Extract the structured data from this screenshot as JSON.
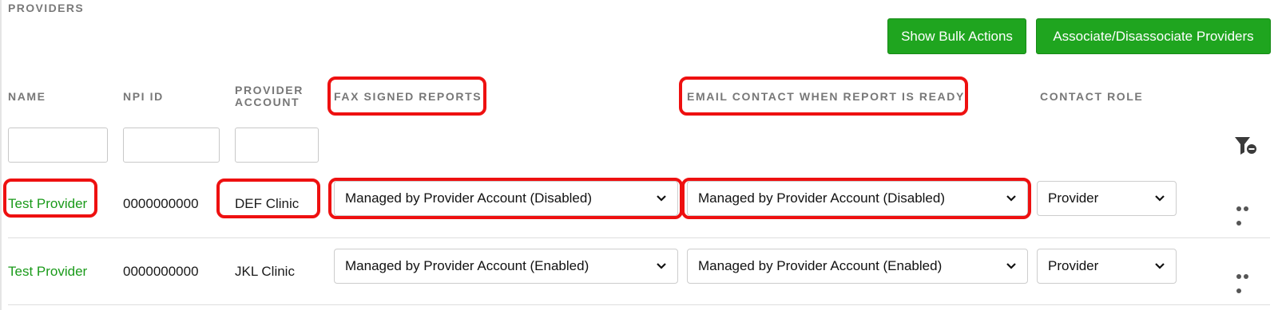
{
  "section": {
    "title": "PROVIDERS"
  },
  "actions": {
    "bulk_label": "Show Bulk Actions",
    "associate_label": "Associate/Disassociate Providers"
  },
  "columns": {
    "name": "NAME",
    "npi": "NPI ID",
    "account_line1": "PROVIDER",
    "account_line2": "ACCOUNT",
    "fax": "FAX SIGNED REPORTS",
    "email": "EMAIL CONTACT WHEN REPORT IS READY",
    "role": "CONTACT ROLE"
  },
  "filters": {
    "name": "",
    "npi": "",
    "account": ""
  },
  "rows": [
    {
      "name": "Test Provider",
      "npi": "0000000000",
      "account": "DEF Clinic",
      "fax": "Managed by Provider Account (Disabled)",
      "email": "Managed by Provider Account (Disabled)",
      "role": "Provider"
    },
    {
      "name": "Test Provider",
      "npi": "0000000000",
      "account": "JKL Clinic",
      "fax": "Managed by Provider Account (Enabled)",
      "email": "Managed by Provider Account (Enabled)",
      "role": "Provider"
    }
  ],
  "icons": {
    "filter": "filter-remove-icon",
    "more": "more-horizontal-icon",
    "dropdown": "chevron-down-icon"
  },
  "colors": {
    "accent": "#1fa51f",
    "link": "#1a9a1a",
    "highlight": "#ee1010",
    "header_text": "#777777"
  }
}
